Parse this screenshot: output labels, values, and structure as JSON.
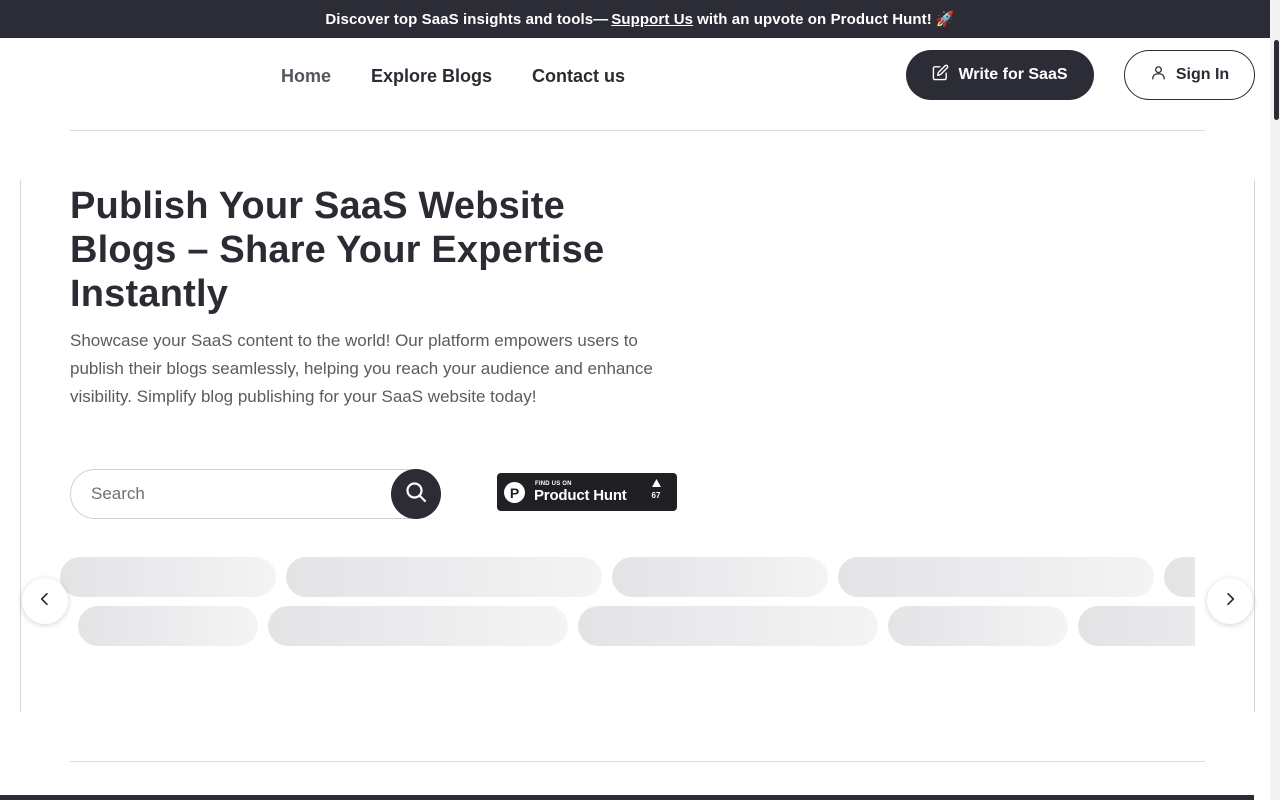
{
  "announcement": {
    "text_before": "Discover top SaaS insights and tools—",
    "link_label": "Support Us",
    "text_after": "with an upvote on Product Hunt!",
    "emoji": "🚀"
  },
  "nav": {
    "items": [
      {
        "label": "Home"
      },
      {
        "label": "Explore Blogs"
      },
      {
        "label": "Contact us"
      }
    ],
    "write_button": "Write for SaaS",
    "signin_button": "Sign In"
  },
  "hero": {
    "title": "Publish Your SaaS Website Blogs – Share Your Expertise Instantly",
    "description": "Showcase your SaaS content to the world! Our platform empowers users to publish their blogs seamlessly, helping you reach your audience and enhance visibility. Simplify blog publishing for your SaaS website today!"
  },
  "search": {
    "placeholder": "Search",
    "value": ""
  },
  "product_hunt": {
    "logo_letter": "P",
    "small_text": "FIND US ON",
    "name": "Product Hunt",
    "upvote_count": "67"
  },
  "icons": {
    "write": "pencil-square-icon",
    "signin": "user-icon",
    "search": "magnifier-icon",
    "prev": "chevron-left-icon",
    "next": "chevron-right-icon",
    "upvote": "triangle-up-icon"
  },
  "colors": {
    "dark": "#2b2c36",
    "text": "#2a2b33",
    "muted": "#5a5b62",
    "skeleton": "#e4e4e6"
  }
}
